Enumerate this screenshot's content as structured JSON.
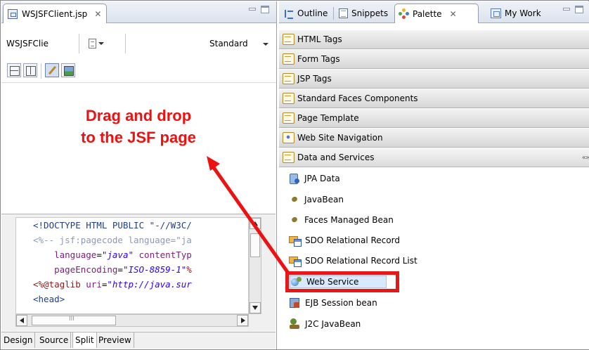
{
  "editor": {
    "tab_title": "WSJSFClient.jsp",
    "tab_close": "✕",
    "toolbar_file_label": "WSJSFClie",
    "mode_dropdown": "Standard",
    "code_lines": [
      [
        {
          "t": "<!DOCTYPE HTML PUBLIC \"-//W3C/",
          "c": "c-doc"
        }
      ],
      [
        {
          "t": "<%-- jsf:pagecode language=\"ja",
          "c": "c-com"
        }
      ],
      [
        {
          "t": "    language",
          "c": "c-attr"
        },
        {
          "t": "=",
          "c": "c-eq"
        },
        {
          "t": "\"java\"",
          "c": "c-str"
        },
        {
          "t": " contentTyp",
          "c": "c-attr"
        }
      ],
      [
        {
          "t": "    pageEncoding",
          "c": "c-attr"
        },
        {
          "t": "=",
          "c": "c-eq"
        },
        {
          "t": "\"ISO-8859-1\"",
          "c": "c-str"
        },
        {
          "t": "%",
          "c": "c-tag"
        }
      ],
      [
        {
          "t": "<%@taglib ",
          "c": "c-tag"
        },
        {
          "t": "uri",
          "c": "c-attr"
        },
        {
          "t": "=",
          "c": "c-eq"
        },
        {
          "t": "\"http://java.sur",
          "c": "c-str"
        }
      ],
      [
        {
          "t": "<head>",
          "c": "c-blue"
        }
      ],
      [
        {
          "t": "   ",
          "c": "c-com"
        }
      ]
    ],
    "hscroll_label": "III",
    "bottom_tabs": [
      "Design",
      "Source",
      "Split",
      "Preview"
    ],
    "active_bottom_tab": "Split"
  },
  "palette_view": {
    "tabs": [
      {
        "label": "Outline",
        "icon": "outline-icon"
      },
      {
        "label": "Snippets",
        "icon": "snippets-icon"
      },
      {
        "label": "Palette",
        "icon": "palette-icon"
      },
      {
        "label": "My Work",
        "icon": "my-work-icon"
      }
    ],
    "active_tab": "Palette",
    "tab_close": "✕",
    "drawers": [
      {
        "label": "HTML Tags"
      },
      {
        "label": "Form Tags"
      },
      {
        "label": "JSP Tags"
      },
      {
        "label": "Standard Faces Components"
      },
      {
        "label": "Page Template"
      },
      {
        "label": "Web Site Navigation"
      },
      {
        "label": "Data and Services"
      }
    ],
    "open_drawer_pin": "«»",
    "items": [
      {
        "label": "JPA Data",
        "icon": "jpa-data-icon"
      },
      {
        "label": "JavaBean",
        "icon": "javabean-icon"
      },
      {
        "label": "Faces Managed Bean",
        "icon": "managed-bean-icon"
      },
      {
        "label": "SDO Relational Record",
        "icon": "sdo-record-icon"
      },
      {
        "label": "SDO Relational Record List",
        "icon": "sdo-record-list-icon"
      },
      {
        "label": "Web Service",
        "icon": "web-service-icon"
      },
      {
        "label": "EJB Session bean",
        "icon": "ejb-session-bean-icon"
      },
      {
        "label": "J2C JavaBean",
        "icon": "j2c-javabean-icon"
      }
    ],
    "selected_item": "Web Service"
  },
  "annotation": {
    "line1": "Drag and drop",
    "line2": "to the JSF page",
    "color": "#ee1111"
  },
  "colors": {
    "highlight_box": "#e81616",
    "selection_fill": "#d9e9ff"
  }
}
